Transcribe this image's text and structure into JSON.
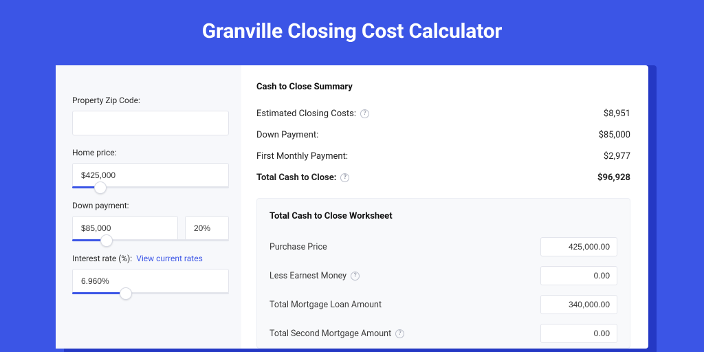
{
  "page_title": "Granville Closing Cost Calculator",
  "form": {
    "zip": {
      "label": "Property Zip Code:",
      "value": ""
    },
    "home_price": {
      "label": "Home price:",
      "value": "$425,000",
      "slider_pct": 18
    },
    "down_payment": {
      "label": "Down payment:",
      "value": "$85,000",
      "pct": "20%",
      "slider_pct": 22
    },
    "interest": {
      "label": "Interest rate (%):",
      "link_text": "View current rates",
      "value": "6.960%",
      "slider_pct": 34
    }
  },
  "summary": {
    "title": "Cash to Close Summary",
    "rows": [
      {
        "label": "Estimated Closing Costs:",
        "help": true,
        "value": "$8,951",
        "bold": false
      },
      {
        "label": "Down Payment:",
        "help": false,
        "value": "$85,000",
        "bold": false
      },
      {
        "label": "First Monthly Payment:",
        "help": false,
        "value": "$2,977",
        "bold": false
      },
      {
        "label": "Total Cash to Close:",
        "help": true,
        "value": "$96,928",
        "bold": true
      }
    ]
  },
  "worksheet": {
    "title": "Total Cash to Close Worksheet",
    "rows": [
      {
        "label": "Purchase Price",
        "help": false,
        "value": "425,000.00"
      },
      {
        "label": "Less Earnest Money",
        "help": true,
        "value": "0.00"
      },
      {
        "label": "Total Mortgage Loan Amount",
        "help": false,
        "value": "340,000.00"
      },
      {
        "label": "Total Second Mortgage Amount",
        "help": true,
        "value": "0.00"
      }
    ]
  }
}
